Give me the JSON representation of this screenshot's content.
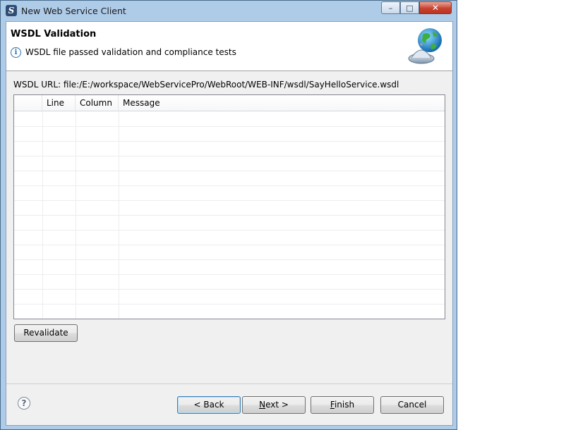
{
  "window": {
    "title": "New Web Service Client",
    "controls": {
      "minimize": "–",
      "maximize": "□",
      "close": "✕"
    },
    "app_icon": "eclipse-icon"
  },
  "banner": {
    "title": "WSDL Validation",
    "message": "WSDL file passed validation and compliance tests",
    "info_icon": "info-icon",
    "image": "globe-service-icon"
  },
  "wsdl": {
    "url_label": "WSDL URL: file:/E:/workspace/WebServicePro/WebRoot/WEB-INF/wsdl/SayHelloService.wsdl"
  },
  "table": {
    "columns": [
      "",
      "Line",
      "Column",
      "Message"
    ],
    "rows": []
  },
  "buttons": {
    "revalidate": "Revalidate",
    "back": "< Back",
    "next_mnemonic": "N",
    "next_rest": "ext >",
    "finish_mnemonic": "F",
    "finish_rest": "inish",
    "cancel": "Cancel",
    "help": "?"
  }
}
